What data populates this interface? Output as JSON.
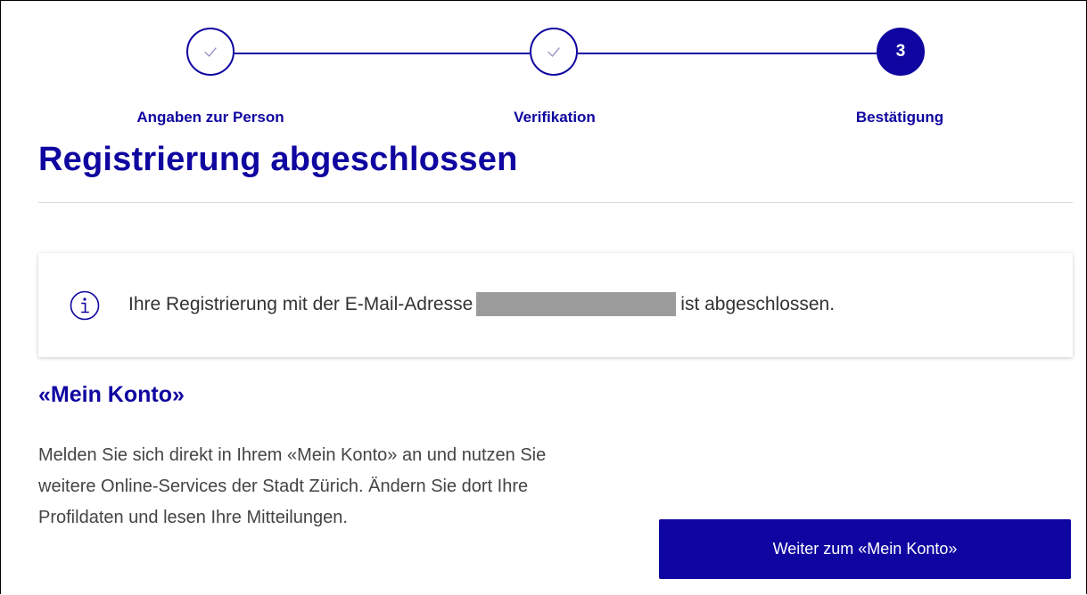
{
  "stepper": {
    "steps": [
      {
        "label": "Angaben zur Person",
        "state": "done",
        "icon": "check-icon"
      },
      {
        "label": "Verifikation",
        "state": "done",
        "icon": "check-icon"
      },
      {
        "label": "Bestätigung",
        "state": "active",
        "number": "3"
      }
    ]
  },
  "page": {
    "title": "Registrierung abgeschlossen"
  },
  "info": {
    "icon": "info-icon",
    "text_before": "Ihre Registrierung mit der E-Mail-Adresse",
    "text_after": "ist abgeschlossen."
  },
  "account": {
    "heading": "«Mein Konto»",
    "description": "Melden Sie sich direkt in Ihrem «Mein Konto» an und nutzen Sie weitere Online-Services der Stadt Zürich. Ändern Sie dort Ihre Profildaten und lesen Ihre Mitteilungen.",
    "button_label": "Weiter zum «Mein Konto»"
  },
  "colors": {
    "brand": "#0f05a0",
    "redaction": "#9b9b9b"
  }
}
